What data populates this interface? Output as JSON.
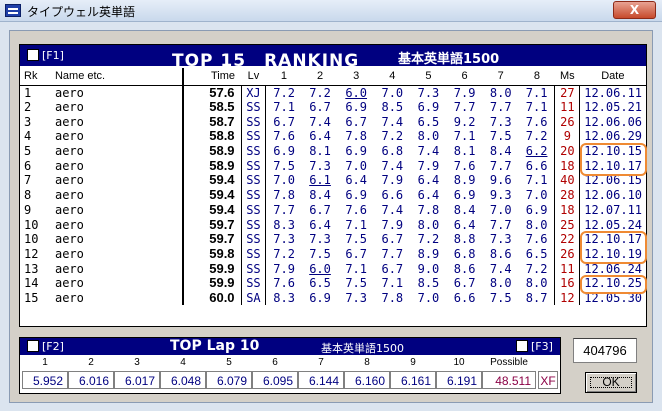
{
  "window": {
    "title": "タイプウェル英単語",
    "close_label": "X"
  },
  "ranking": {
    "f1_label": "[F1]",
    "title": "TOP 15　RANKING",
    "subtitle": "基本英単語1500",
    "headers": {
      "rk": "Rk",
      "name": "Name etc.",
      "time": "Time",
      "lv": "Lv",
      "laps": [
        "1",
        "2",
        "3",
        "4",
        "5",
        "6",
        "7",
        "8"
      ],
      "ms": "Ms",
      "date": "Date"
    },
    "rows": [
      {
        "rk": "1",
        "name": "aero",
        "time": "57.6",
        "lv": "XJ",
        "laps": [
          "7.2",
          "7.2",
          "6.0",
          "7.0",
          "7.3",
          "7.9",
          "8.0",
          "7.1"
        ],
        "ms": "27",
        "date": "12.06.11"
      },
      {
        "rk": "2",
        "name": "aero",
        "time": "58.5",
        "lv": "SS",
        "laps": [
          "7.1",
          "6.7",
          "6.9",
          "8.5",
          "6.9",
          "7.7",
          "7.7",
          "7.1"
        ],
        "ms": "11",
        "date": "12.05.21"
      },
      {
        "rk": "3",
        "name": "aero",
        "time": "58.7",
        "lv": "SS",
        "laps": [
          "6.7",
          "7.4",
          "6.7",
          "7.4",
          "6.5",
          "9.2",
          "7.3",
          "7.6"
        ],
        "ms": "26",
        "date": "12.06.06"
      },
      {
        "rk": "4",
        "name": "aero",
        "time": "58.8",
        "lv": "SS",
        "laps": [
          "7.6",
          "6.4",
          "7.8",
          "7.2",
          "8.0",
          "7.1",
          "7.5",
          "7.2"
        ],
        "ms": "9",
        "date": "12.06.29"
      },
      {
        "rk": "5",
        "name": "aero",
        "time": "58.9",
        "lv": "SS",
        "laps": [
          "6.9",
          "8.1",
          "6.9",
          "6.8",
          "7.4",
          "8.1",
          "8.4",
          "6.2"
        ],
        "ms": "20",
        "date": "12.10.15"
      },
      {
        "rk": "6",
        "name": "aero",
        "time": "58.9",
        "lv": "SS",
        "laps": [
          "7.5",
          "7.3",
          "7.0",
          "7.4",
          "7.9",
          "7.6",
          "7.7",
          "6.6"
        ],
        "ms": "18",
        "date": "12.10.17"
      },
      {
        "rk": "7",
        "name": "aero",
        "time": "59.4",
        "lv": "SS",
        "laps": [
          "7.0",
          "6.1",
          "6.4",
          "7.9",
          "6.4",
          "8.9",
          "9.6",
          "7.1"
        ],
        "ms": "40",
        "date": "12.06.15"
      },
      {
        "rk": "8",
        "name": "aero",
        "time": "59.4",
        "lv": "SS",
        "laps": [
          "7.8",
          "8.4",
          "6.9",
          "6.6",
          "6.4",
          "6.9",
          "9.3",
          "7.0"
        ],
        "ms": "28",
        "date": "12.06.10"
      },
      {
        "rk": "9",
        "name": "aero",
        "time": "59.4",
        "lv": "SS",
        "laps": [
          "7.7",
          "6.7",
          "7.6",
          "7.4",
          "7.8",
          "8.4",
          "7.0",
          "6.9"
        ],
        "ms": "18",
        "date": "12.07.11"
      },
      {
        "rk": "10",
        "name": "aero",
        "time": "59.7",
        "lv": "SS",
        "laps": [
          "8.3",
          "6.4",
          "7.1",
          "7.9",
          "8.0",
          "6.4",
          "7.7",
          "8.0"
        ],
        "ms": "25",
        "date": "12.05.24"
      },
      {
        "rk": "10",
        "name": "aero",
        "time": "59.7",
        "lv": "SS",
        "laps": [
          "7.3",
          "7.3",
          "7.5",
          "6.7",
          "7.2",
          "8.8",
          "7.3",
          "7.6"
        ],
        "ms": "22",
        "date": "12.10.17"
      },
      {
        "rk": "12",
        "name": "aero",
        "time": "59.8",
        "lv": "SS",
        "laps": [
          "7.2",
          "7.5",
          "6.7",
          "7.7",
          "8.9",
          "6.8",
          "8.6",
          "6.5"
        ],
        "ms": "26",
        "date": "12.10.19"
      },
      {
        "rk": "13",
        "name": "aero",
        "time": "59.9",
        "lv": "SS",
        "laps": [
          "7.9",
          "6.0",
          "7.1",
          "6.7",
          "9.0",
          "8.6",
          "7.4",
          "7.2"
        ],
        "ms": "11",
        "date": "12.06.24"
      },
      {
        "rk": "14",
        "name": "aero",
        "time": "59.9",
        "lv": "SS",
        "laps": [
          "7.6",
          "6.5",
          "7.5",
          "7.1",
          "8.5",
          "6.7",
          "8.0",
          "8.0"
        ],
        "ms": "16",
        "date": "12.10.25"
      },
      {
        "rk": "15",
        "name": "aero",
        "time": "60.0",
        "lv": "SA",
        "laps": [
          "8.3",
          "6.9",
          "7.3",
          "7.8",
          "7.0",
          "6.6",
          "7.5",
          "8.7"
        ],
        "ms": "12",
        "date": "12.05.30"
      }
    ],
    "underlined": [
      [
        0,
        2
      ],
      [
        4,
        7
      ],
      [
        6,
        1
      ],
      [
        12,
        1
      ]
    ],
    "highlighted_rows": [
      [
        4,
        5
      ],
      [
        10,
        11
      ],
      [
        13,
        13
      ]
    ]
  },
  "lap": {
    "f2_label": "[F2]",
    "title": "TOP Lap 10",
    "subtitle": "基本英単語1500",
    "f3_label": "[F3]",
    "numbers": [
      "1",
      "2",
      "3",
      "4",
      "5",
      "6",
      "7",
      "8",
      "9",
      "10"
    ],
    "possible_header": "Possible",
    "values": [
      "5.952",
      "6.016",
      "6.017",
      "6.048",
      "6.079",
      "6.095",
      "6.144",
      "6.160",
      "6.161",
      "6.191"
    ],
    "possible_value": "48.511",
    "possible_level": "XF"
  },
  "score": "404796",
  "ok_label": "OK",
  "colors": {
    "header_bg": "#000080",
    "highlight": "#ef8a33",
    "miss_color": "#b00000"
  }
}
